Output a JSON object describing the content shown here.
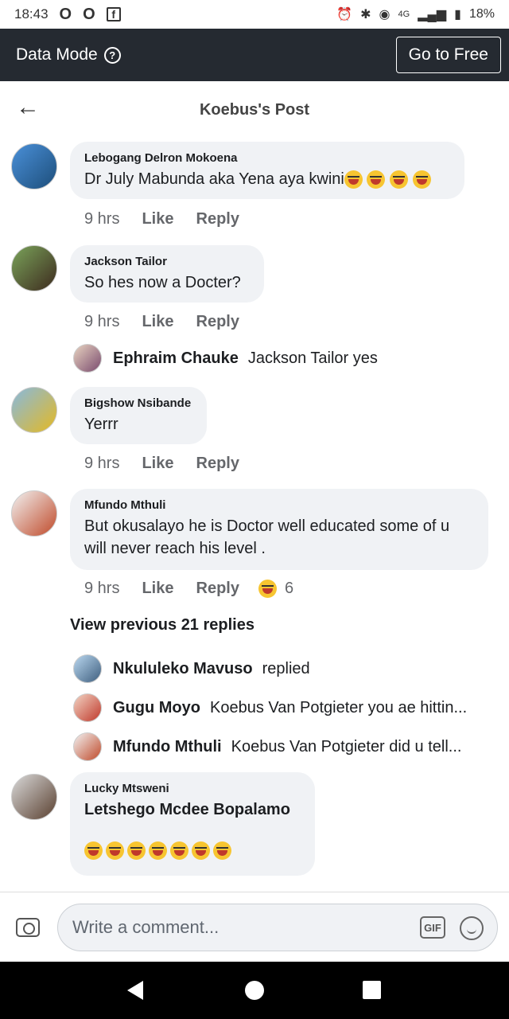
{
  "status_bar": {
    "time": "18:43",
    "icons_left": [
      "opera-o-icon",
      "opera-o-icon",
      "facebook-icon"
    ],
    "battery": "18%",
    "network": "4G"
  },
  "data_mode": {
    "label": "Data Mode",
    "help_icon": "?",
    "button": "Go to Free"
  },
  "header": {
    "back_icon": "←",
    "title": "Koebus's Post"
  },
  "comments": [
    {
      "author": "Lebogang Delron Mokoena",
      "text": "Dr July Mabunda aka Yena aya kwini",
      "emojis": 4,
      "time": "9 hrs",
      "like": "Like",
      "reply": "Reply"
    },
    {
      "author": "Jackson Tailor",
      "text": "So hes now a Docter?",
      "time": "9 hrs",
      "like": "Like",
      "reply": "Reply",
      "replies": [
        {
          "name": "Ephraim Chauke",
          "text": "Jackson Tailor yes"
        }
      ]
    },
    {
      "author": "Bigshow Nsibande",
      "text": "Yerrr",
      "time": "9 hrs",
      "like": "Like",
      "reply": "Reply"
    },
    {
      "author": "Mfundo Mthuli",
      "text": "But okusalayo he is Doctor  well educated  some of u will never reach his level .",
      "time": "9 hrs",
      "like": "Like",
      "reply": "Reply",
      "reaction_count": "6",
      "view_previous": "View previous 21 replies",
      "replies": [
        {
          "name": "Nkululeko Mavuso",
          "text": "replied"
        },
        {
          "name": "Gugu Moyo",
          "text": "Koebus Van Potgieter you ae hittin..."
        },
        {
          "name": "Mfundo Mthuli",
          "text": "Koebus Van Potgieter did u tell..."
        }
      ]
    },
    {
      "author": "Lucky Mtsweni",
      "text": "Letshego Mcdee Bopalamo",
      "emojis": 7
    }
  ],
  "composer": {
    "placeholder": "Write a comment...",
    "gif_label": "GIF"
  }
}
